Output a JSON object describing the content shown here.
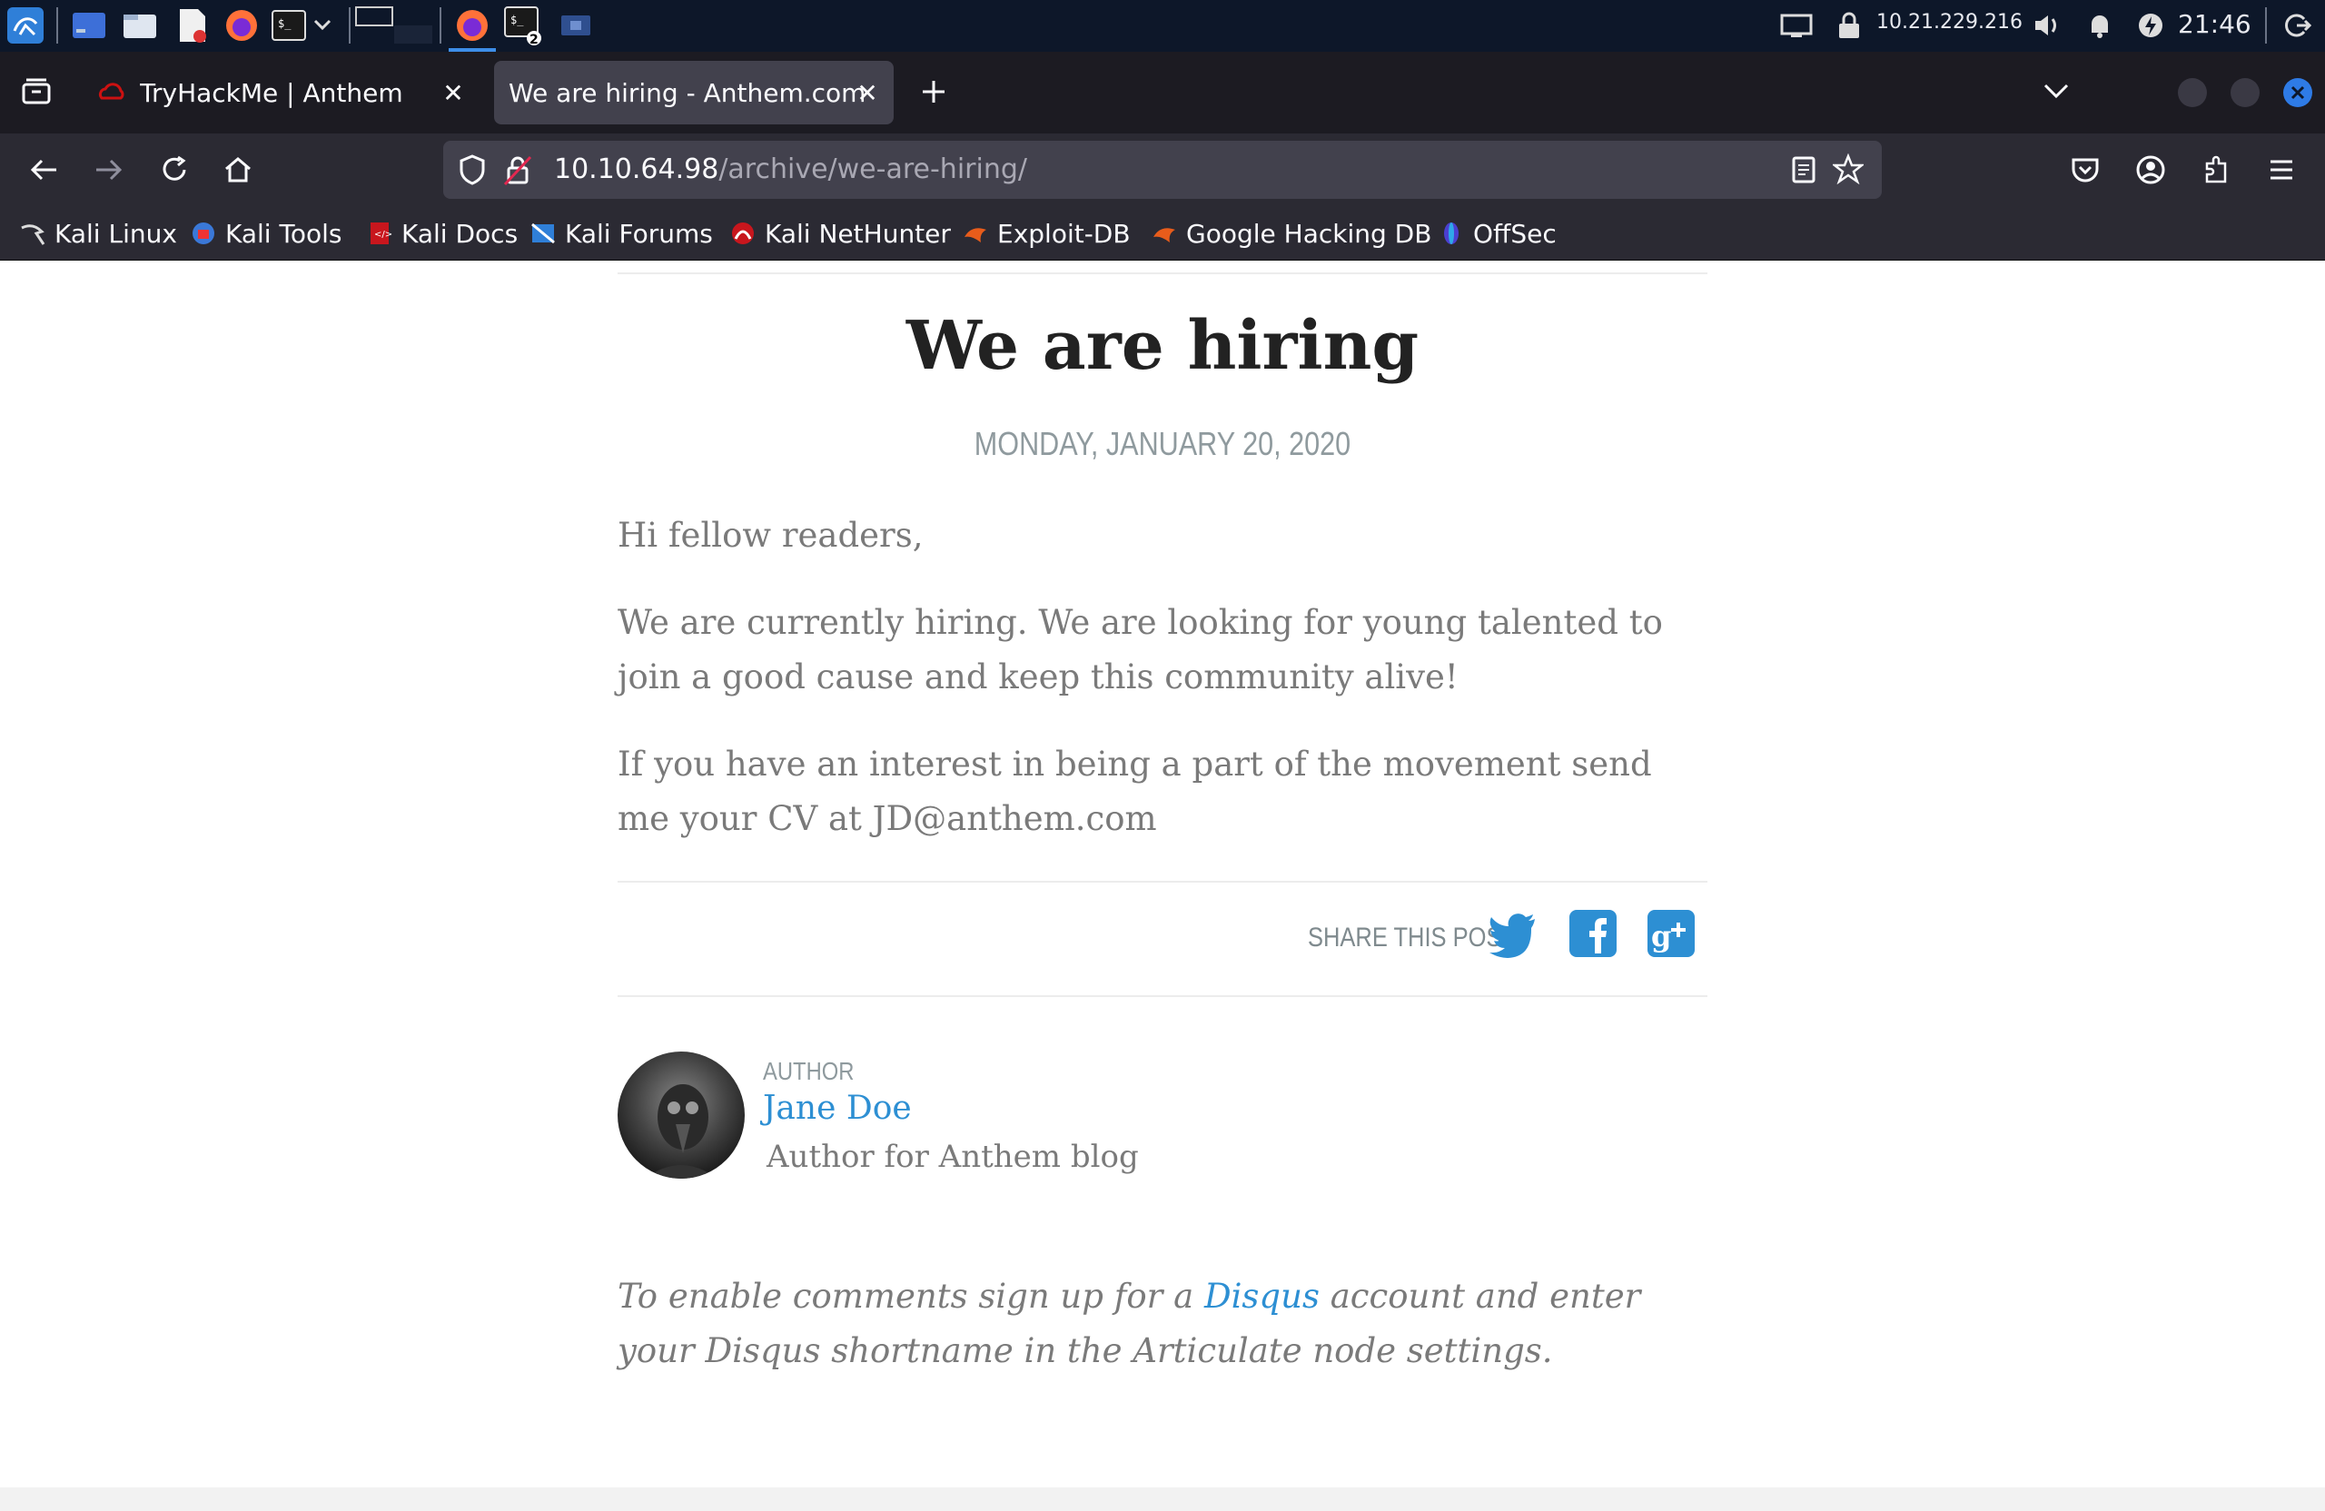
{
  "taskbar": {
    "ip_address": "10.21.229.216",
    "clock": "21:46",
    "terminal_badge": "2"
  },
  "browser": {
    "tabs": [
      {
        "label": "TryHackMe | Anthem",
        "active": false
      },
      {
        "label": "We are hiring - Anthem.com",
        "active": true
      }
    ],
    "url": {
      "host": "10.10.64.98",
      "path": "/archive/we-are-hiring/"
    },
    "bookmarks": [
      {
        "label": "Kali Linux",
        "icon": "kali-dragon-icon"
      },
      {
        "label": "Kali Tools",
        "icon": "kali-tools-icon"
      },
      {
        "label": "Kali Docs",
        "icon": "kali-docs-icon"
      },
      {
        "label": "Kali Forums",
        "icon": "kali-forums-icon"
      },
      {
        "label": "Kali NetHunter",
        "icon": "kali-nethunter-icon"
      },
      {
        "label": "Exploit-DB",
        "icon": "exploit-db-icon"
      },
      {
        "label": "Google Hacking DB",
        "icon": "ghdb-icon"
      },
      {
        "label": "OffSec",
        "icon": "offsec-icon"
      }
    ]
  },
  "post": {
    "title": "We are hiring",
    "date": "MONDAY, JANUARY 20, 2020",
    "paragraphs": [
      "Hi fellow readers,",
      "We are currently hiring. We are looking for young talented to join a good cause and keep this community alive!",
      "If you have an interest in being a part of the movement send me your CV at JD@anthem.com"
    ],
    "share_label": "SHARE THIS POST",
    "author_label": "AUTHOR",
    "author_name": "Jane Doe",
    "author_desc": "Author for Anthem blog",
    "comments_prefix": "To enable comments sign up for a ",
    "comments_link": "Disqus",
    "comments_suffix": " account and enter your Disqus shortname in the Articulate node settings."
  },
  "colors": {
    "accent_link": "#2d8fd3",
    "taskbar_bg": "#0d1729",
    "tabbar_bg": "#1c1b22",
    "navbar_bg": "#2b2a33"
  }
}
